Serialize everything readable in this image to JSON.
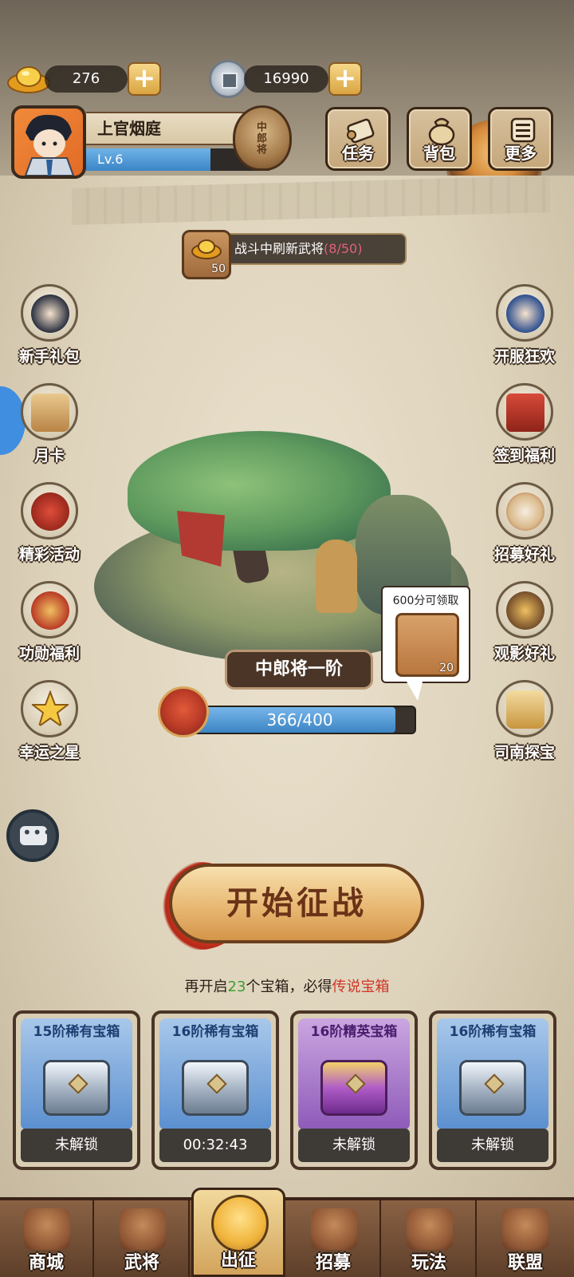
{
  "currency": {
    "gold": {
      "icon": "gold-ingot-icon",
      "value": "276"
    },
    "silver": {
      "icon": "silver-coin-icon",
      "value": "16990"
    }
  },
  "player": {
    "name": "上官烟庭",
    "level": "Lv.6",
    "level_progress": 0.68,
    "rank_badge": "中郎将"
  },
  "top_menu": [
    {
      "label": "任务",
      "icon": "scroll-icon"
    },
    {
      "label": "背包",
      "icon": "bag-icon"
    },
    {
      "label": "更多",
      "icon": "menu-icon"
    }
  ],
  "refresh_banner": {
    "cost": "50",
    "text": "战斗中刷新武将",
    "count": "(8/50)"
  },
  "left_buttons": [
    {
      "label": "新手礼包",
      "icon": "hero-gift-icon"
    },
    {
      "label": "月卡",
      "icon": "month-card-icon"
    },
    {
      "label": "精彩活动",
      "icon": "event-bag-icon"
    },
    {
      "label": "功勋福利",
      "icon": "merit-bag-icon"
    },
    {
      "label": "幸运之星",
      "icon": "lucky-star-icon"
    }
  ],
  "right_buttons": [
    {
      "label": "开服狂欢",
      "icon": "carnival-hero-icon"
    },
    {
      "label": "签到福利",
      "icon": "sign-in-icon"
    },
    {
      "label": "招募好礼",
      "icon": "drum-icon"
    },
    {
      "label": "观影好礼",
      "icon": "video-reward-icon"
    },
    {
      "label": "司南探宝",
      "icon": "compass-icon"
    }
  ],
  "stage": {
    "title": "中郎将一阶",
    "progress_text": "366/400",
    "progress_value": 366,
    "progress_max": 400,
    "reward_text": "600分可领取",
    "reward_count": "20"
  },
  "start_button": "开始征战",
  "chest_hint": {
    "prefix": "再开启",
    "count": "23",
    "middle": "个宝箱，必得",
    "highlight": "传说宝箱"
  },
  "chests": [
    {
      "title": "15阶稀有宝箱",
      "status": "未解锁",
      "tier": "rare"
    },
    {
      "title": "16阶稀有宝箱",
      "status": "00:32:43",
      "tier": "rare"
    },
    {
      "title": "16阶精英宝箱",
      "status": "未解锁",
      "tier": "elite"
    },
    {
      "title": "16阶稀有宝箱",
      "status": "未解锁",
      "tier": "rare"
    }
  ],
  "bottom_nav": [
    {
      "label": "商城",
      "icon": "shop-icon",
      "active": false
    },
    {
      "label": "武将",
      "icon": "helmet-icon",
      "active": false
    },
    {
      "label": "出征",
      "icon": "battle-icon",
      "active": true
    },
    {
      "label": "招募",
      "icon": "recruit-icon",
      "active": false
    },
    {
      "label": "玩法",
      "icon": "pavilion-icon",
      "active": false
    },
    {
      "label": "联盟",
      "icon": "alliance-icon",
      "active": false
    }
  ],
  "colors": {
    "progress_blue": "#3b84c3",
    "refresh_count": "#e0607a",
    "hint_green": "#3c9e32",
    "hint_red": "#d0362a"
  }
}
